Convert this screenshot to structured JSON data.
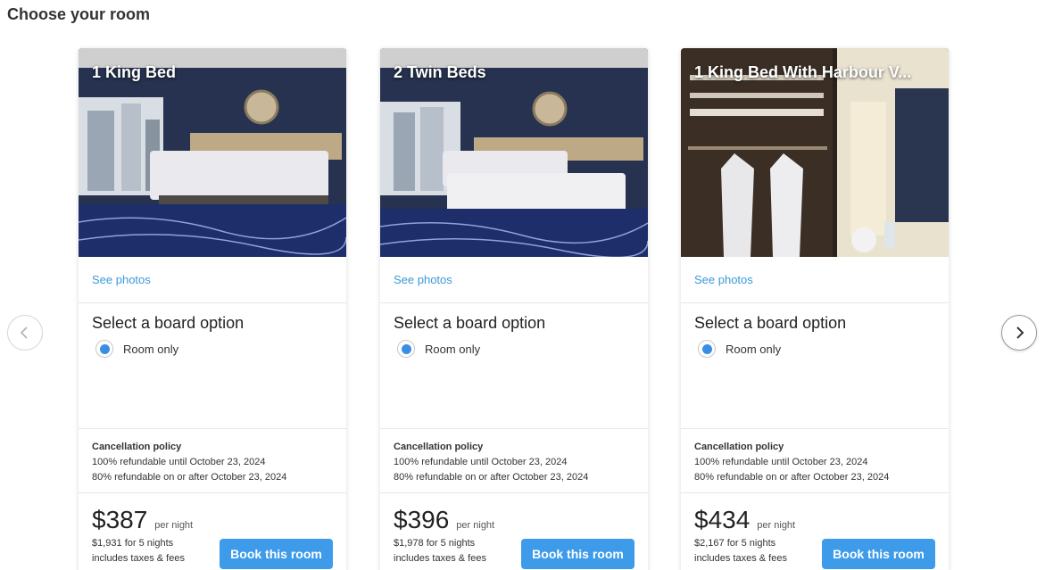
{
  "page": {
    "title": "Choose your room"
  },
  "nav": {
    "prev_icon": "chevron-left-icon",
    "next_icon": "chevron-right-icon"
  },
  "rooms": [
    {
      "title": "1 King Bed",
      "see_photos": "See photos",
      "board_heading": "Select a board option",
      "board_option": "Room only",
      "cancellation_heading": "Cancellation policy",
      "cancellation_line1": "100% refundable until October 23, 2024",
      "cancellation_line2": "80% refundable on or after October 23, 2024",
      "price": "$387",
      "per_night": "per night",
      "total": "$1,931 for 5 nights",
      "taxes": "includes taxes & fees",
      "book_label": "Book this room"
    },
    {
      "title": "2 Twin Beds",
      "see_photos": "See photos",
      "board_heading": "Select a board option",
      "board_option": "Room only",
      "cancellation_heading": "Cancellation policy",
      "cancellation_line1": "100% refundable until October 23, 2024",
      "cancellation_line2": "80% refundable on or after October 23, 2024",
      "price": "$396",
      "per_night": "per night",
      "total": "$1,978 for 5 nights",
      "taxes": "includes taxes & fees",
      "book_label": "Book this room"
    },
    {
      "title": "1 King Bed With Harbour V...",
      "see_photos": "See photos",
      "board_heading": "Select a board option",
      "board_option": "Room only",
      "cancellation_heading": "Cancellation policy",
      "cancellation_line1": "100% refundable until October 23, 2024",
      "cancellation_line2": "80% refundable on or after October 23, 2024",
      "price": "$434",
      "per_night": "per night",
      "total": "$2,167 for 5 nights",
      "taxes": "includes taxes & fees",
      "book_label": "Book this room"
    }
  ],
  "colors": {
    "link": "#3a9ad9",
    "button": "#3d9be9",
    "radio": "#3a8ee6"
  }
}
